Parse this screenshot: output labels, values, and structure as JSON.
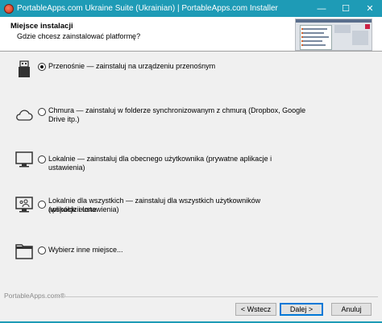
{
  "window": {
    "title": "PortableApps.com Ukraine Suite (Ukrainian) | PortableApps.com Installer",
    "controls": {
      "minimize": "—",
      "maximize": "☐",
      "close": "✕"
    }
  },
  "header": {
    "title": "Miejsce instalacji",
    "subtitle": "Gdzie chcesz zainstalować platformę?"
  },
  "options": [
    {
      "id": "portable",
      "icon": "usb-drive-icon",
      "label": "Przenośnie — zainstaluj na urządzeniu przenośnym",
      "label2": "",
      "selected": true
    },
    {
      "id": "cloud",
      "icon": "cloud-icon",
      "label": "Chmura — zainstaluj w folderze synchronizowanym z chmurą (Dropbox, Google",
      "label2": "Drive itp.)",
      "selected": false
    },
    {
      "id": "local",
      "icon": "monitor-icon",
      "label": "Lokalnie — zainstaluj dla obecnego użytkownika (prywatne aplikacje i ustawienia)",
      "label2": "",
      "selected": false
    },
    {
      "id": "local-all",
      "icon": "users-monitor-icon",
      "label": "Lokalnie dla wszystkich — zainstaluj dla wszystkich użytkowników (współdzielone",
      "label2": "aplikacje i ustawienia)",
      "selected": false
    },
    {
      "id": "custom",
      "icon": "folder-icon",
      "label": "Wybierz inne miejsce...",
      "label2": "",
      "selected": false
    }
  ],
  "footer": {
    "brand": "PortableApps.com®",
    "back_label": "< Wstecz",
    "next_label": "Dalej >",
    "cancel_label": "Anuluj"
  },
  "colors": {
    "titlebar": "#1e9bb6",
    "accent": "#0078d7"
  }
}
